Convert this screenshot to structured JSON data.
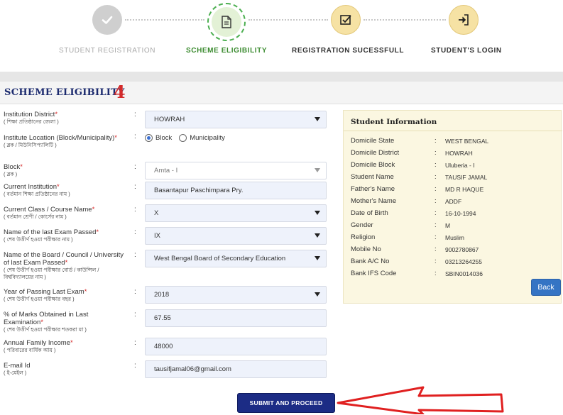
{
  "stepper": {
    "steps": [
      {
        "label": "STUDENT REGISTRATION",
        "state": "done",
        "icon": "check-icon"
      },
      {
        "label": "SCHEME ELIGIBILITY",
        "state": "active",
        "icon": "document-icon"
      },
      {
        "label": "REGISTRATION SUCESSFULL",
        "state": "pending",
        "icon": "checkbox-icon"
      },
      {
        "label": "STUDENT'S LOGIN",
        "state": "pending",
        "icon": "login-icon"
      }
    ]
  },
  "section": {
    "title": "SCHEME ELIGIBILITY",
    "annotation_number": "4"
  },
  "form": {
    "institution_district": {
      "label": "Institution District",
      "required": "*",
      "sub": "( শিক্ষা প্রতিষ্ঠানের জেলা )",
      "value": "HOWRAH"
    },
    "institute_location": {
      "label": "Institute Location (Block/Municipality)",
      "required": "*",
      "sub": "( ব্লক / মিউনিসিপ্যালিটি )",
      "options": [
        "Block",
        "Municipality"
      ],
      "selected": "Block"
    },
    "block": {
      "label": "Block",
      "required": "*",
      "sub": "( ব্লক )",
      "value": "Amta - I"
    },
    "current_institution": {
      "label": "Current Institution",
      "required": "*",
      "sub": "( বর্তমান শিক্ষা প্রতিষ্ঠানের নাম )",
      "value": "Basantapur Paschimpara Pry."
    },
    "current_class": {
      "label": "Current Class / Course Name",
      "required": "*",
      "sub": "( বর্তমান শ্রেণী / কোর্সের নাম )",
      "value": "X"
    },
    "last_exam": {
      "label": "Name of the last Exam Passed",
      "required": "*",
      "sub": "( শেষ উত্তীর্ণ হওয়া পরীক্ষার নাম )",
      "value": "IX"
    },
    "board": {
      "label": "Name of the Board / Council / University of last Exam Passed",
      "required": "*",
      "sub": "( শেষ উত্তীর্ণ হওয়া পরীক্ষার বোর্ড / কাউন্সিল / বিশ্ববিদ্যালয়ের নাম )",
      "value": "West Bengal Board of Secondary Education"
    },
    "year_passing": {
      "label": "Year of Passing Last Exam",
      "required": "*",
      "sub": "( শেষ উত্তীর্ণ হওয়া পরীক্ষার বছর )",
      "value": "2018"
    },
    "marks_percent": {
      "label": "% of Marks Obtained in Last Examination",
      "required": "*",
      "sub": "( শেষ উত্তীর্ণ হওয়া পরীক্ষার শতকরা মা )",
      "value": "67.55"
    },
    "family_income": {
      "label": "Annual Family Income",
      "required": "*",
      "sub": "( পরিবারের বার্ষিক আয় )",
      "value": "48000"
    },
    "email": {
      "label": "E-mail Id",
      "required": "",
      "sub": "( ই-মেইল )",
      "value": "tausifjamal06@gmail.com"
    },
    "colon": ":"
  },
  "student_info": {
    "title": "Student Information",
    "separator": ":",
    "rows": [
      {
        "key": "Domicile State",
        "value": "WEST BENGAL"
      },
      {
        "key": "Domicile District",
        "value": "HOWRAH"
      },
      {
        "key": "Domicile Block",
        "value": "Uluberia - I"
      },
      {
        "key": "Student Name",
        "value": "TAUSIF JAMAL"
      },
      {
        "key": "Father's Name",
        "value": "MD R HAQUE"
      },
      {
        "key": "Mother's Name",
        "value": "ADDF"
      },
      {
        "key": "Date of Birth",
        "value": "16-10-1994"
      },
      {
        "key": "Gender",
        "value": "M"
      },
      {
        "key": "Religion",
        "value": "Muslim"
      },
      {
        "key": "Mobile No",
        "value": "9002780867"
      },
      {
        "key": "Bank A/C No",
        "value": "03213264255"
      },
      {
        "key": "Bank IFS Code",
        "value": "SBIN0014036"
      }
    ],
    "back_label": "Back"
  },
  "actions": {
    "submit_label": "SUBMIT AND PROCEED"
  },
  "colors": {
    "primary_dark": "#1c2c85",
    "active_step": "#4caf50",
    "pending_step": "#f6e2a4",
    "required": "#d62828",
    "annotation": "#d42a2a",
    "info_bg": "#fbf7e1",
    "back_button": "#3574c4"
  }
}
